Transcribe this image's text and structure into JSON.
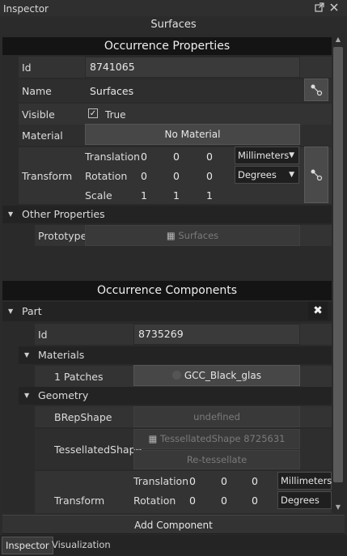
{
  "panel": {
    "title": "Inspector",
    "subtitle": "Surfaces"
  },
  "occurrence_props": {
    "header": "Occurrence Properties",
    "id_label": "Id",
    "id_value": "8741065",
    "name_label": "Name",
    "name_value": "Surfaces",
    "visible_label": "Visible",
    "visible_value": "True",
    "visible_checked": true,
    "material_label": "Material",
    "material_value": "No Material",
    "transform_label": "Transform",
    "translation_label": "Translation",
    "translation": [
      "0",
      "0",
      "0"
    ],
    "translation_unit": "Millimeters",
    "rotation_label": "Rotation",
    "rotation": [
      "0",
      "0",
      "0"
    ],
    "rotation_unit": "Degrees",
    "scale_label": "Scale",
    "scale": [
      "1",
      "1",
      "1"
    ]
  },
  "other_props": {
    "header": "Other Properties",
    "prototype_label": "Prototype",
    "prototype_value": "Surfaces"
  },
  "components": {
    "header": "Occurrence Components",
    "part_label": "Part",
    "id_label": "Id",
    "id_value": "8735269",
    "materials_label": "Materials",
    "patches_label": "1 Patches",
    "patches_value": "GCC_Black_glas",
    "geometry_label": "Geometry",
    "brep_label": "BRepShape",
    "brep_value": "undefined",
    "tess_label": "TessellatedShape",
    "tess_value": "TessellatedShape 8725631",
    "retess_label": "Re-tessellate",
    "transform_label": "Transform",
    "translation_label": "Translation",
    "translation": [
      "0",
      "0",
      "0"
    ],
    "translation_unit": "Millimeters",
    "rotation_label": "Rotation",
    "rotation": [
      "0",
      "0",
      "0"
    ],
    "rotation_unit": "Degrees"
  },
  "footer": {
    "add_component": "Add Component"
  },
  "tabs": [
    "Inspector",
    "Visualization"
  ]
}
